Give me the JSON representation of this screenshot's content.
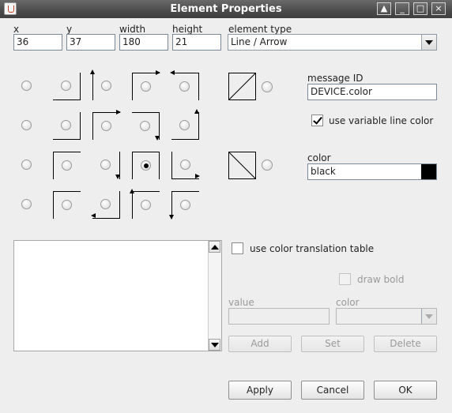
{
  "window": {
    "title": "Element Properties",
    "controls": [
      "▲",
      "_",
      "□",
      "×"
    ]
  },
  "fields": {
    "x": {
      "label": "x",
      "value": "36"
    },
    "y": {
      "label": "y",
      "value": "37"
    },
    "width": {
      "label": "width",
      "value": "180"
    },
    "height": {
      "label": "height",
      "value": "21"
    },
    "element_type": {
      "label": "element type",
      "value": "Line / Arrow"
    }
  },
  "line_style_grid": {
    "rows": 4,
    "cols": 5,
    "selected": "row 3, col 4"
  },
  "message_id": {
    "label": "message ID",
    "value": "DEVICE.color"
  },
  "use_variable_line_color": {
    "label": "use variable line color",
    "checked": true
  },
  "color": {
    "label": "color",
    "value": "black",
    "swatch": "#000000"
  },
  "use_color_translation_table": {
    "label": "use color translation table",
    "checked": false
  },
  "draw_bold": {
    "label": "draw bold",
    "checked": false,
    "enabled": false
  },
  "translation": {
    "value_label": "value",
    "color_label": "color"
  },
  "table_buttons": {
    "add": "Add",
    "set": "Set",
    "delete": "Delete"
  },
  "dialog_buttons": {
    "apply": "Apply",
    "cancel": "Cancel",
    "ok": "OK"
  },
  "colors": {
    "titlebar": "#4a4a4a",
    "background": "#eeeeee"
  }
}
